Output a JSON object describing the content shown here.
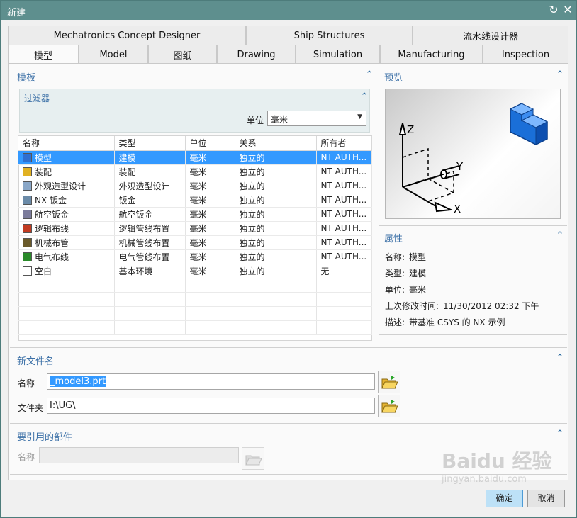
{
  "window": {
    "title": "新建"
  },
  "tabs_row1": [
    "Mechatronics Concept Designer",
    "Ship Structures",
    "流水线设计器"
  ],
  "tabs_row2": [
    "模型",
    "Model",
    "图纸",
    "Drawing",
    "Simulation",
    "Manufacturing",
    "Inspection"
  ],
  "template": {
    "header": "模板",
    "filter_header": "过滤器",
    "unit_label": "单位",
    "unit_value": "毫米",
    "columns": [
      "名称",
      "类型",
      "单位",
      "关系",
      "所有者"
    ],
    "rows": [
      {
        "name": "模型",
        "type": "建模",
        "unit": "毫米",
        "relation": "独立的",
        "owner": "NT AUTH...",
        "icon": "model-part-icon",
        "selected": true
      },
      {
        "name": "装配",
        "type": "装配",
        "unit": "毫米",
        "relation": "独立的",
        "owner": "NT AUTH...",
        "icon": "assembly-icon"
      },
      {
        "name": "外观造型设计",
        "type": "外观造型设计",
        "unit": "毫米",
        "relation": "独立的",
        "owner": "NT AUTH...",
        "icon": "shape-studio-icon"
      },
      {
        "name": "NX 钣金",
        "type": "钣金",
        "unit": "毫米",
        "relation": "独立的",
        "owner": "NT AUTH...",
        "icon": "sheet-metal-icon"
      },
      {
        "name": "航空钣金",
        "type": "航空钣金",
        "unit": "毫米",
        "relation": "独立的",
        "owner": "NT AUTH...",
        "icon": "aero-sheet-metal-icon"
      },
      {
        "name": "逻辑布线",
        "type": "逻辑管线布置",
        "unit": "毫米",
        "relation": "独立的",
        "owner": "NT AUTH...",
        "icon": "logical-routing-icon"
      },
      {
        "name": "机械布管",
        "type": "机械管线布置",
        "unit": "毫米",
        "relation": "独立的",
        "owner": "NT AUTH...",
        "icon": "mechanical-routing-icon"
      },
      {
        "name": "电气布线",
        "type": "电气管线布置",
        "unit": "毫米",
        "relation": "独立的",
        "owner": "NT AUTH...",
        "icon": "electrical-routing-icon"
      },
      {
        "name": "空白",
        "type": "基本环境",
        "unit": "毫米",
        "relation": "独立的",
        "owner": "无",
        "icon": "blank-file-icon"
      }
    ]
  },
  "preview": {
    "header": "预览",
    "axes": [
      "Z",
      "Y",
      "X"
    ]
  },
  "properties": {
    "header": "属性",
    "items": [
      {
        "label": "名称:",
        "value": "模型"
      },
      {
        "label": "类型:",
        "value": "建模"
      },
      {
        "label": "单位:",
        "value": "毫米"
      },
      {
        "label": "上次修改时间:",
        "value": "11/30/2012 02:32 下午"
      },
      {
        "label": "描述:",
        "value": "带基准 CSYS 的 NX 示例"
      }
    ]
  },
  "new_file": {
    "header": "新文件名",
    "name_label": "名称",
    "name_value": "_model3.prt",
    "folder_label": "文件夹",
    "folder_value": "I:\\UG\\"
  },
  "ref_part": {
    "header": "要引用的部件",
    "name_label": "名称"
  },
  "buttons": {
    "ok": "确定",
    "cancel": "取消"
  },
  "watermark": "Baidu 经验",
  "watermark_sub": "jingyan.baidu.com"
}
